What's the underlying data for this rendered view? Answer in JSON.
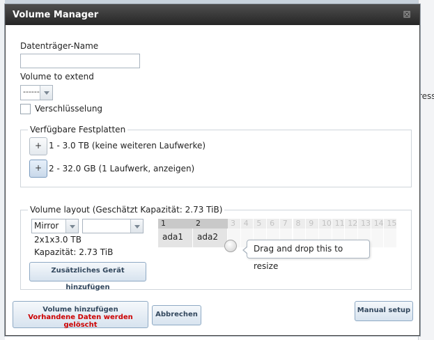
{
  "background": {
    "right_partial_text": "ress"
  },
  "dialog": {
    "title": "Volume Manager",
    "close_glyph": "⊠"
  },
  "form": {
    "volume_name_label": "Datenträger-Name",
    "volume_name_value": "",
    "volume_to_extend_label": "Volume to extend",
    "volume_to_extend_value": "------",
    "encryption_label": "Verschlüsselung",
    "encryption_checked": false
  },
  "available_disks": {
    "legend": "Verfügbare Festplatten",
    "items": [
      {
        "button": "+",
        "label": "1 - 3.0 TB (keine weiteren Laufwerke)"
      },
      {
        "button": "+",
        "label": "2 - 32.0 GB (1 Laufwerk, anzeigen)"
      }
    ]
  },
  "volume_layout": {
    "legend": "Volume layout (Geschätzt Kapazität: 2.73 TiB)",
    "layout_select_value": "Mirror",
    "second_select_value": "",
    "summary": "2x1x3.0 TB",
    "capacity": "Kapazität: 2.73 TiB",
    "add_device_button": "Zusätzliches Gerät hinzufügen",
    "columns": [
      "1",
      "2",
      "3",
      "4",
      "5",
      "6",
      "7",
      "8",
      "9",
      "10",
      "11",
      "12",
      "13",
      "14",
      "15"
    ],
    "active_columns": 2,
    "disks": [
      "ada1",
      "ada2"
    ],
    "resize_tooltip": "Drag and drop this to resize"
  },
  "buttons": {
    "add_volume_line1": "Volume hinzufügen",
    "add_volume_line2": "Vorhandene Daten werden gelöscht",
    "cancel": "Abbrechen",
    "manual_setup": "Manual setup"
  },
  "colors": {
    "titlebar": "#333333",
    "warning_text": "#cc0000",
    "button_text": "#33485e"
  }
}
